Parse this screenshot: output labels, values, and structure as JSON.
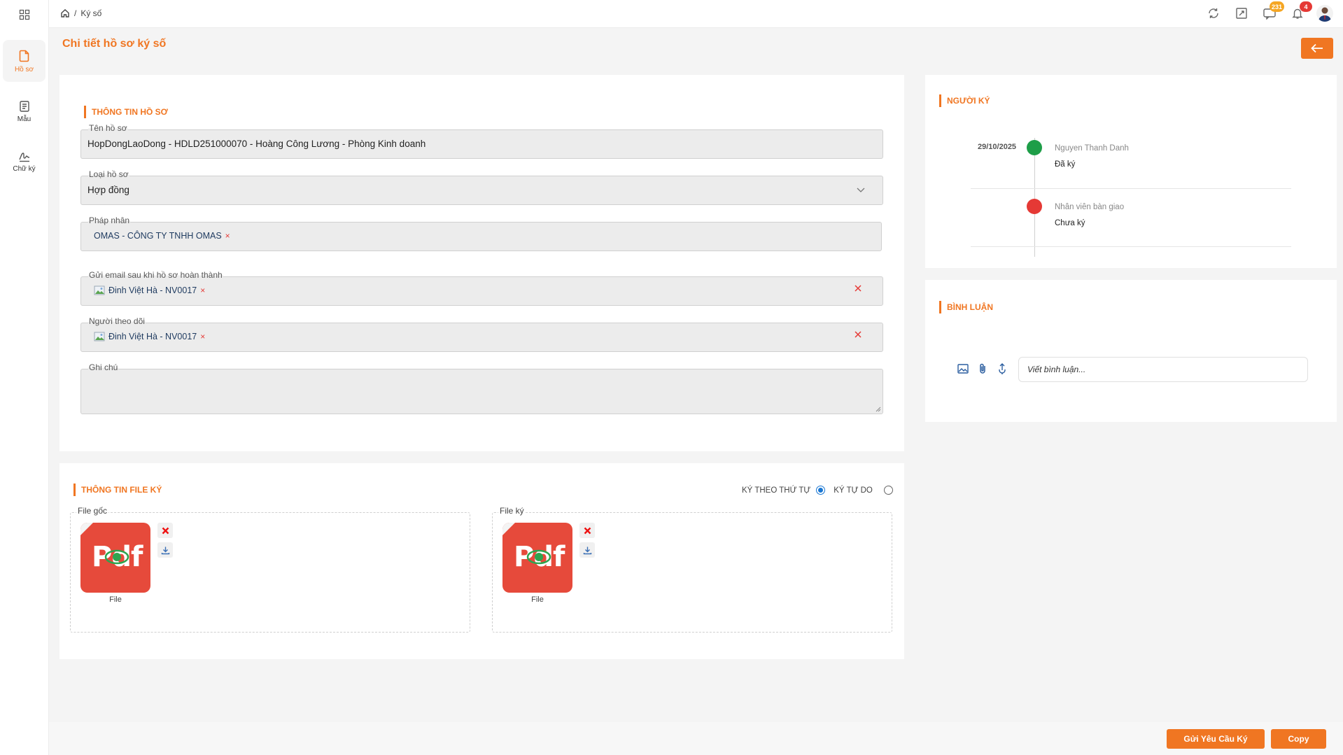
{
  "nav": {
    "items": [
      {
        "label": "Hồ sơ"
      },
      {
        "label": "Mẫu"
      },
      {
        "label": "Chữ ký"
      }
    ]
  },
  "header": {
    "breadcrumb_sep": "/",
    "breadcrumb": "Ký số",
    "badges": {
      "messages": "231",
      "notifications": "4"
    }
  },
  "page": {
    "title": "Chi tiết hồ sơ ký số"
  },
  "info": {
    "section_title": "THÔNG TIN HỒ SƠ",
    "name_label": "Tên hồ sơ",
    "name_value": "HopDongLaoDong - HDLD251000070 - Hoàng Công Lương - Phòng Kinh doanh",
    "type_label": "Loại hồ sơ",
    "type_value": "Hợp đồng",
    "legal_label": "Pháp nhân",
    "legal_chip": "OMAS - CÔNG TY TNHH OMAS",
    "email_label": "Gửi email sau khi hồ sơ hoàn thành",
    "email_chip": "Đinh Việt Hà - NV0017",
    "follower_label": "Người theo dõi",
    "follower_chip": "Đinh Việt Hà - NV0017",
    "note_label": "Ghi chú",
    "note_value": "",
    "chip_remove": "×"
  },
  "files": {
    "section_title": "THÔNG TIN FILE KÝ",
    "order_label": "KÝ THEO THỨ TỰ",
    "free_label": "KÝ TỰ DO",
    "original_label": "File gốc",
    "signed_label": "File ký",
    "icon_text": "Pdf",
    "original_file_name": "File",
    "signed_file_name": "File"
  },
  "signers": {
    "section_title": "NGƯỜI KÝ",
    "list": [
      {
        "date": "29/10/2025",
        "name": "Nguyen Thanh Danh",
        "status": "Đã ký",
        "color": "#1e9e48"
      },
      {
        "date": "",
        "name": "Nhân viên bàn giao",
        "status": "Chưa ký",
        "color": "#e53935"
      }
    ]
  },
  "comments": {
    "section_title": "BÌNH LUẬN",
    "placeholder": "Viết bình luận..."
  },
  "footer": {
    "send_label": "Gửi Yêu Cầu Ký",
    "copy_label": "Copy"
  },
  "colors": {
    "accent": "#f07622",
    "signed": "#1e9e48",
    "unsigned": "#e53935"
  }
}
